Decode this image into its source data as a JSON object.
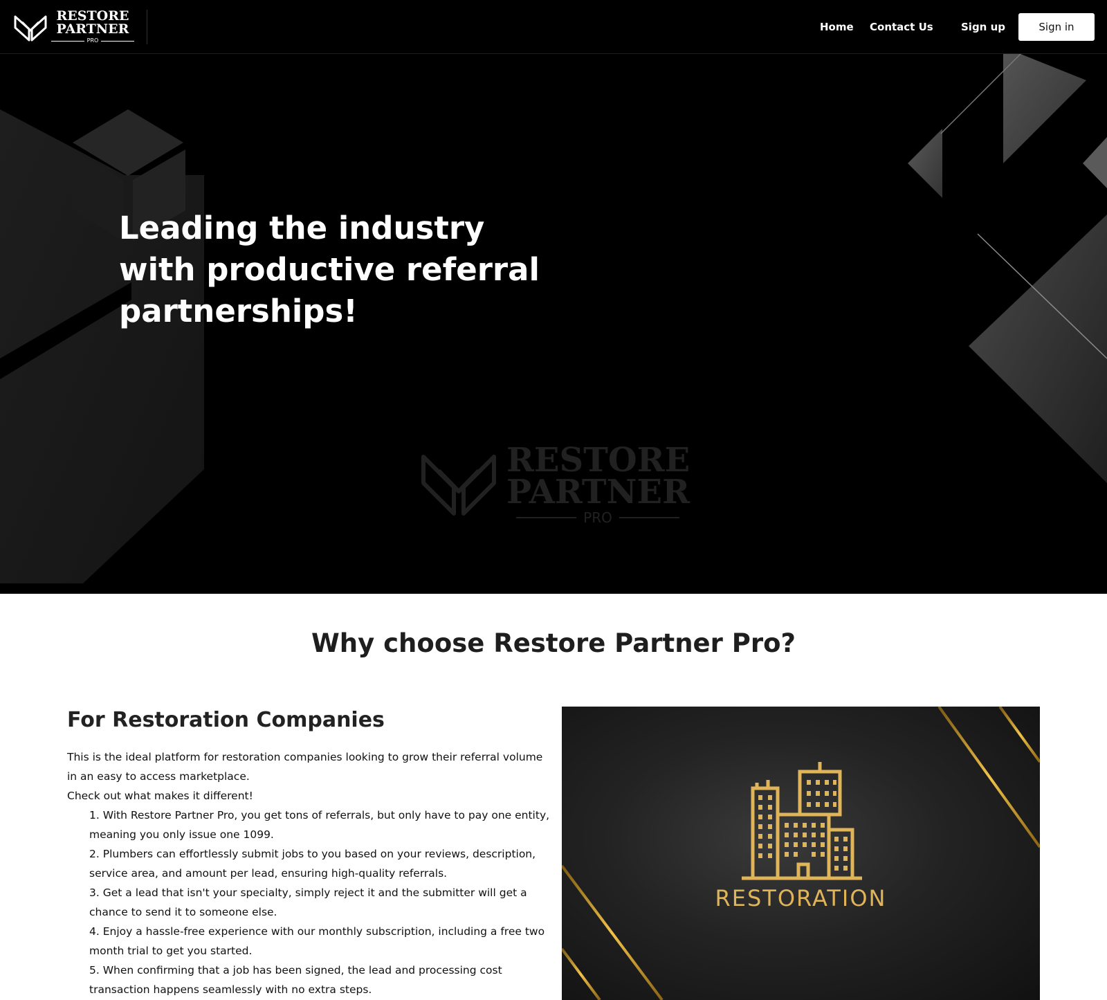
{
  "header": {
    "logo": {
      "word1": "RESTORE",
      "word2": "PARTNER",
      "word3": "PRO"
    },
    "nav": {
      "home": "Home",
      "contact": "Contact Us",
      "signup": "Sign up",
      "signin": "Sign in"
    }
  },
  "hero": {
    "title": "Leading the industry with productive referral partnerships!",
    "watermark": {
      "word1": "RESTORE",
      "word2": "PARTNER",
      "word3": "PRO"
    }
  },
  "why": {
    "title": "Why choose Restore Partner Pro?",
    "section_title": "For Restoration Companies",
    "intro": "This is the ideal platform for restoration companies looking to grow their referral volume in an easy to access marketplace.",
    "intro2": "Check out what makes it different!",
    "points": [
      "1. With Restore Partner Pro, you get tons of referrals, but only have to pay one entity, meaning you only issue one 1099.",
      "2. Plumbers can effortlessly submit jobs to you based on your reviews, description, service area, and amount per lead, ensuring high-quality referrals.",
      "3. Get a lead that isn't your specialty, simply reject it and the submitter will get a chance to send it to someone else.",
      "4. Enjoy a hassle-free experience with our monthly subscription, including a free two month trial to get you started.",
      "5. When confirming that a job has been signed, the lead and processing cost transaction happens seamlessly with no extra steps."
    ],
    "image_label": "RESTORATION"
  },
  "colors": {
    "header_bg": "#000000",
    "hero_bg": "#000000",
    "gold": "#e0b55a",
    "text_dark": "#1e1e1e"
  },
  "icons": {
    "logo": "chevron-shield-icon",
    "restoration": "buildings-icon"
  }
}
